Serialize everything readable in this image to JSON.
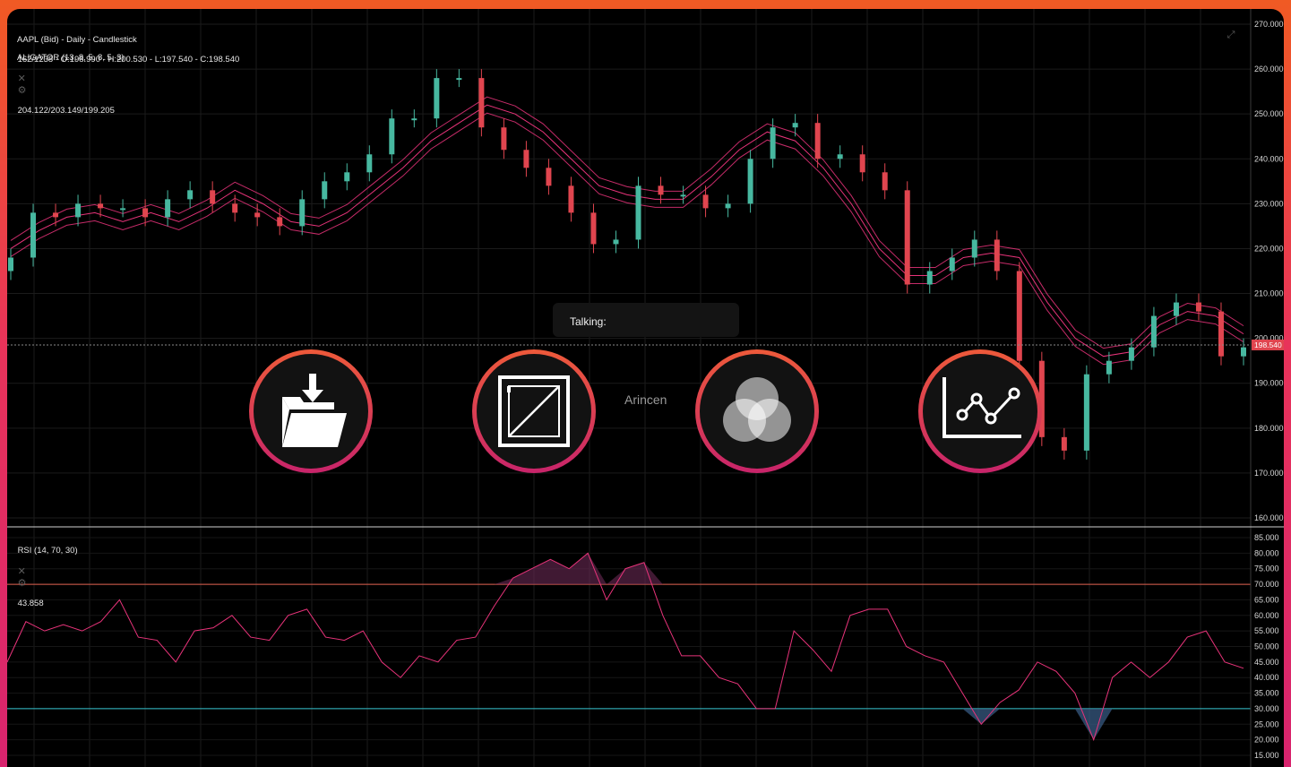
{
  "main_chart": {
    "symbol_line": "AAPL (Bid) - Daily - Candlestick",
    "ohlc_line": "162/1238 - O:198.990 - H:200.530 - L:197.540 - C:198.540",
    "indicator_name": "ALIGATOR (13, 8, 5, 8, 5, 3)",
    "indicator_values": "204.122/203.149/199.205",
    "close_icon": "✕",
    "settings_icon": "⚙",
    "expand_icon": "⤢",
    "current_price_label": "198.540",
    "price_axis_labels": [
      "270.000",
      "260.000",
      "250.000",
      "240.000",
      "230.000",
      "220.000",
      "210.000",
      "200.000",
      "190.000",
      "180.000",
      "170.000",
      "160.000"
    ]
  },
  "rsi_panel": {
    "name": "RSI (14, 70, 30)",
    "value": "43.858",
    "axis_labels": [
      "85.000",
      "80.000",
      "75.000",
      "70.000",
      "65.000",
      "60.000",
      "55.000",
      "50.000",
      "45.000",
      "40.000",
      "35.000",
      "30.000",
      "25.000",
      "20.000",
      "15.000"
    ]
  },
  "overlay": {
    "talking_label": "Talking:",
    "center_label": "Arincen",
    "buttons": [
      {
        "icon": "open-folder-icon"
      },
      {
        "icon": "crop-resize-icon"
      },
      {
        "icon": "color-circles-icon"
      },
      {
        "icon": "line-graph-icon"
      }
    ]
  },
  "colors": {
    "up_candle": "#47b8a0",
    "down_candle": "#e0454f",
    "alligator_line": "#e8337a",
    "rsi_line": "#e8337a",
    "overbought_line": "#e2604f",
    "oversold_line": "#36c4cf",
    "accent_gradient_top": "#ee5a3a",
    "accent_gradient_bottom": "#c8246a"
  },
  "chart_data": [
    {
      "type": "line",
      "title": "AAPL (Bid) - Daily - Candlestick",
      "series": [
        {
          "name": "ALIGATOR (13, 8, 5, 8, 5, 3)",
          "values": [
            220,
            224,
            227,
            228,
            226,
            228,
            226,
            229,
            233,
            230,
            226,
            225,
            228,
            233,
            238,
            244,
            248,
            252,
            250,
            246,
            240,
            234,
            232,
            231,
            231,
            236,
            242,
            246,
            244,
            238,
            230,
            220,
            214,
            214,
            218,
            219,
            218,
            208,
            200,
            196,
            197,
            203,
            206,
            205,
            201
          ]
        }
      ],
      "candles_close": [
        218,
        228,
        227,
        230,
        229,
        229,
        227,
        231,
        233,
        230,
        228,
        227,
        225,
        231,
        235,
        237,
        241,
        249,
        249,
        258,
        258,
        247,
        242,
        238,
        234,
        228,
        221,
        222,
        234,
        232,
        232,
        229,
        230,
        240,
        247,
        248,
        240,
        241,
        237,
        233,
        212,
        215,
        218,
        222,
        215,
        195,
        178,
        175,
        192,
        195,
        198,
        205,
        208,
        206,
        196,
        198
      ],
      "ylim": [
        160,
        270
      ]
    },
    {
      "type": "line",
      "title": "RSI (14, 70, 30)",
      "series": [
        {
          "name": "RSI (14, 70, 30)",
          "values": [
            45,
            58,
            55,
            57,
            55,
            58,
            65,
            53,
            52,
            45,
            55,
            56,
            60,
            53,
            52,
            60,
            62,
            53,
            52,
            55,
            45,
            40,
            47,
            45,
            52,
            53,
            63,
            72,
            75,
            78,
            75,
            80,
            65,
            75,
            77,
            60,
            47,
            47,
            40,
            38,
            30,
            30,
            55,
            49,
            42,
            60,
            62,
            62,
            50,
            47,
            45,
            35,
            25,
            32,
            36,
            45,
            42,
            35,
            20,
            40,
            45,
            40,
            45,
            53,
            55,
            45,
            43
          ]
        }
      ],
      "reference_lines": [
        70,
        30
      ],
      "ylim": [
        15,
        85
      ]
    }
  ]
}
